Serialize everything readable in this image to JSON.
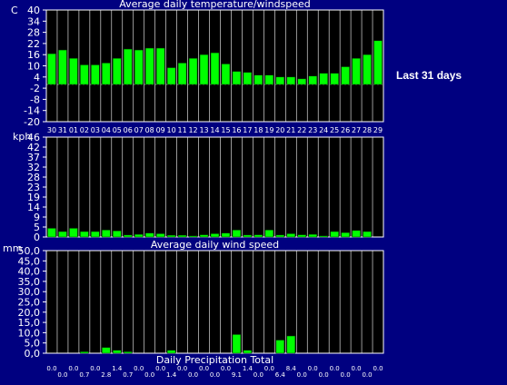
{
  "side_label": "Last 31 days",
  "colors": {
    "background": "#000080",
    "plot_background": "#000000",
    "bar": "#00ff00",
    "grid": "#ffffff",
    "text": "#ffffff"
  },
  "chart_data": [
    {
      "type": "bar",
      "title": "Average daily temperature/windspeed",
      "unit_label": "C",
      "ylim": [
        -20,
        40
      ],
      "y_ticks": [
        "40",
        "34",
        "28",
        "22",
        "16",
        "10",
        "4",
        "-2",
        "-8",
        "-14",
        "-20"
      ],
      "categories": [
        "30",
        "31",
        "01",
        "02",
        "03",
        "04",
        "05",
        "06",
        "07",
        "08",
        "09",
        "10",
        "11",
        "12",
        "13",
        "14",
        "15",
        "16",
        "17",
        "18",
        "19",
        "20",
        "21",
        "22",
        "23",
        "24",
        "25",
        "26",
        "27",
        "28",
        "29"
      ],
      "values": [
        16.5,
        18.5,
        14,
        10.5,
        10.5,
        11.5,
        14,
        19,
        18.5,
        19.5,
        19.5,
        9,
        11.5,
        14,
        16,
        17,
        11,
        7,
        6.5,
        5,
        5,
        4,
        4,
        3,
        4.5,
        6,
        6,
        9.5,
        14,
        16,
        23.5
      ]
    },
    {
      "type": "bar",
      "title": "Average daily wind speed",
      "unit_label": "kph",
      "ylim": [
        0,
        46
      ],
      "y_ticks": [
        "46",
        "42",
        "37",
        "32",
        "28",
        "23",
        "19",
        "14",
        "9",
        "5",
        "0"
      ],
      "values": [
        4,
        2.5,
        4,
        2.5,
        2.5,
        3.2,
        2.8,
        0.9,
        1.2,
        1.8,
        1.5,
        0.8,
        0.8,
        0.5,
        1,
        1.5,
        1.8,
        3.2,
        0.9,
        1,
        3.2,
        0.9,
        1.5,
        1,
        1.2,
        0.5,
        2.5,
        2,
        3,
        2.5,
        0
      ]
    },
    {
      "type": "bar",
      "title": "Daily Precipitation Total",
      "unit_label": "mm",
      "ylim": [
        0,
        50
      ],
      "y_ticks": [
        "50,0",
        "45,0",
        "40,0",
        "35,0",
        "30,0",
        "25,0",
        "20,0",
        "15,0",
        "10,0",
        "5,0",
        "0,0"
      ],
      "values": [
        0,
        0,
        0,
        0.7,
        0,
        2.8,
        1.4,
        0.7,
        0,
        0,
        0,
        1.4,
        0,
        0,
        0,
        0,
        0,
        9.1,
        1.4,
        0,
        0,
        6.4,
        8.4,
        0,
        0,
        0,
        0,
        0,
        0,
        0,
        0
      ],
      "value_labels": [
        "0.0",
        "0.0",
        "0.0",
        "0.7",
        "0.0",
        "2.8",
        "1.4",
        "0.7",
        "0.0",
        "0.0",
        "0.0",
        "1.4",
        "0.0",
        "0.0",
        "0.0",
        "0.0",
        "0.0",
        "9.1",
        "1.4",
        "0.0",
        "0.0",
        "6.4",
        "8.4",
        "0.0",
        "0.0",
        "0.0",
        "0.0",
        "0.0",
        "0.0",
        "0.0",
        "0.0"
      ]
    }
  ]
}
